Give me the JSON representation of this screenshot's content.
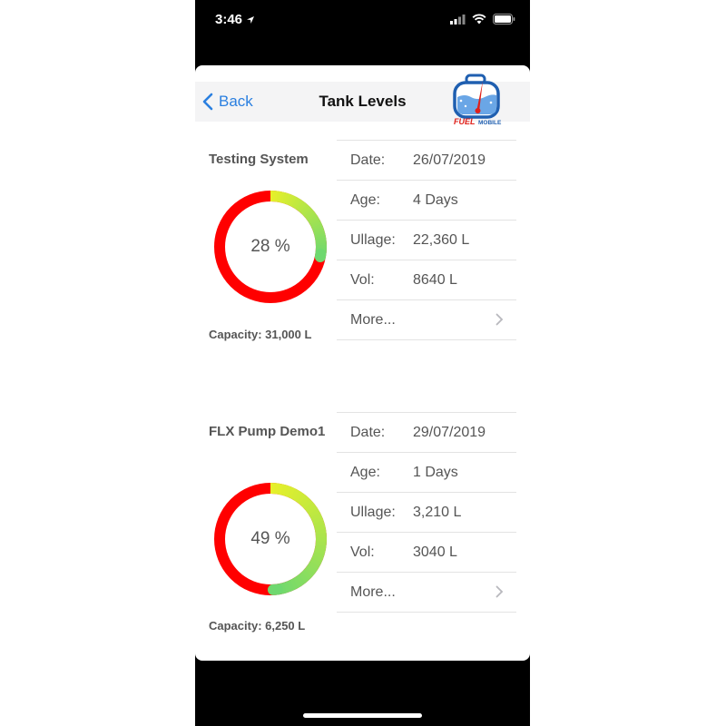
{
  "status_bar": {
    "time": "3:46",
    "icons": [
      "location-arrow-icon",
      "signal-icon",
      "wifi-icon",
      "battery-icon"
    ]
  },
  "nav": {
    "back_label": "Back",
    "title": "Tank Levels"
  },
  "logo": {
    "text": "FUEL",
    "subtext": "MOBILE"
  },
  "tanks": [
    {
      "name": "Testing System",
      "percent_label": "28 %",
      "level_fraction": 0.28,
      "capacity": "Capacity: 31,000 L",
      "rows": [
        {
          "label": "Date:",
          "value": "26/07/2019"
        },
        {
          "label": "Age:",
          "value": "4 Days"
        },
        {
          "label": "Ullage:",
          "value": "22,360 L"
        },
        {
          "label": "Vol:",
          "value": "8640 L"
        }
      ],
      "more_label": "More..."
    },
    {
      "name": "FLX Pump Demo1",
      "percent_label": "49 %",
      "level_fraction": 0.49,
      "capacity": "Capacity: 6,250 L",
      "rows": [
        {
          "label": "Date:",
          "value": "29/07/2019"
        },
        {
          "label": "Age:",
          "value": "1 Days"
        },
        {
          "label": "Ullage:",
          "value": "3,210 L"
        },
        {
          "label": "Vol:",
          "value": "3040 L"
        }
      ],
      "more_label": "More..."
    }
  ],
  "colors": {
    "accent": "#2a7fe0",
    "gauge_red": "#ff0000",
    "gauge_yellow": "#e6f02a",
    "gauge_green": "#6fd86f"
  }
}
